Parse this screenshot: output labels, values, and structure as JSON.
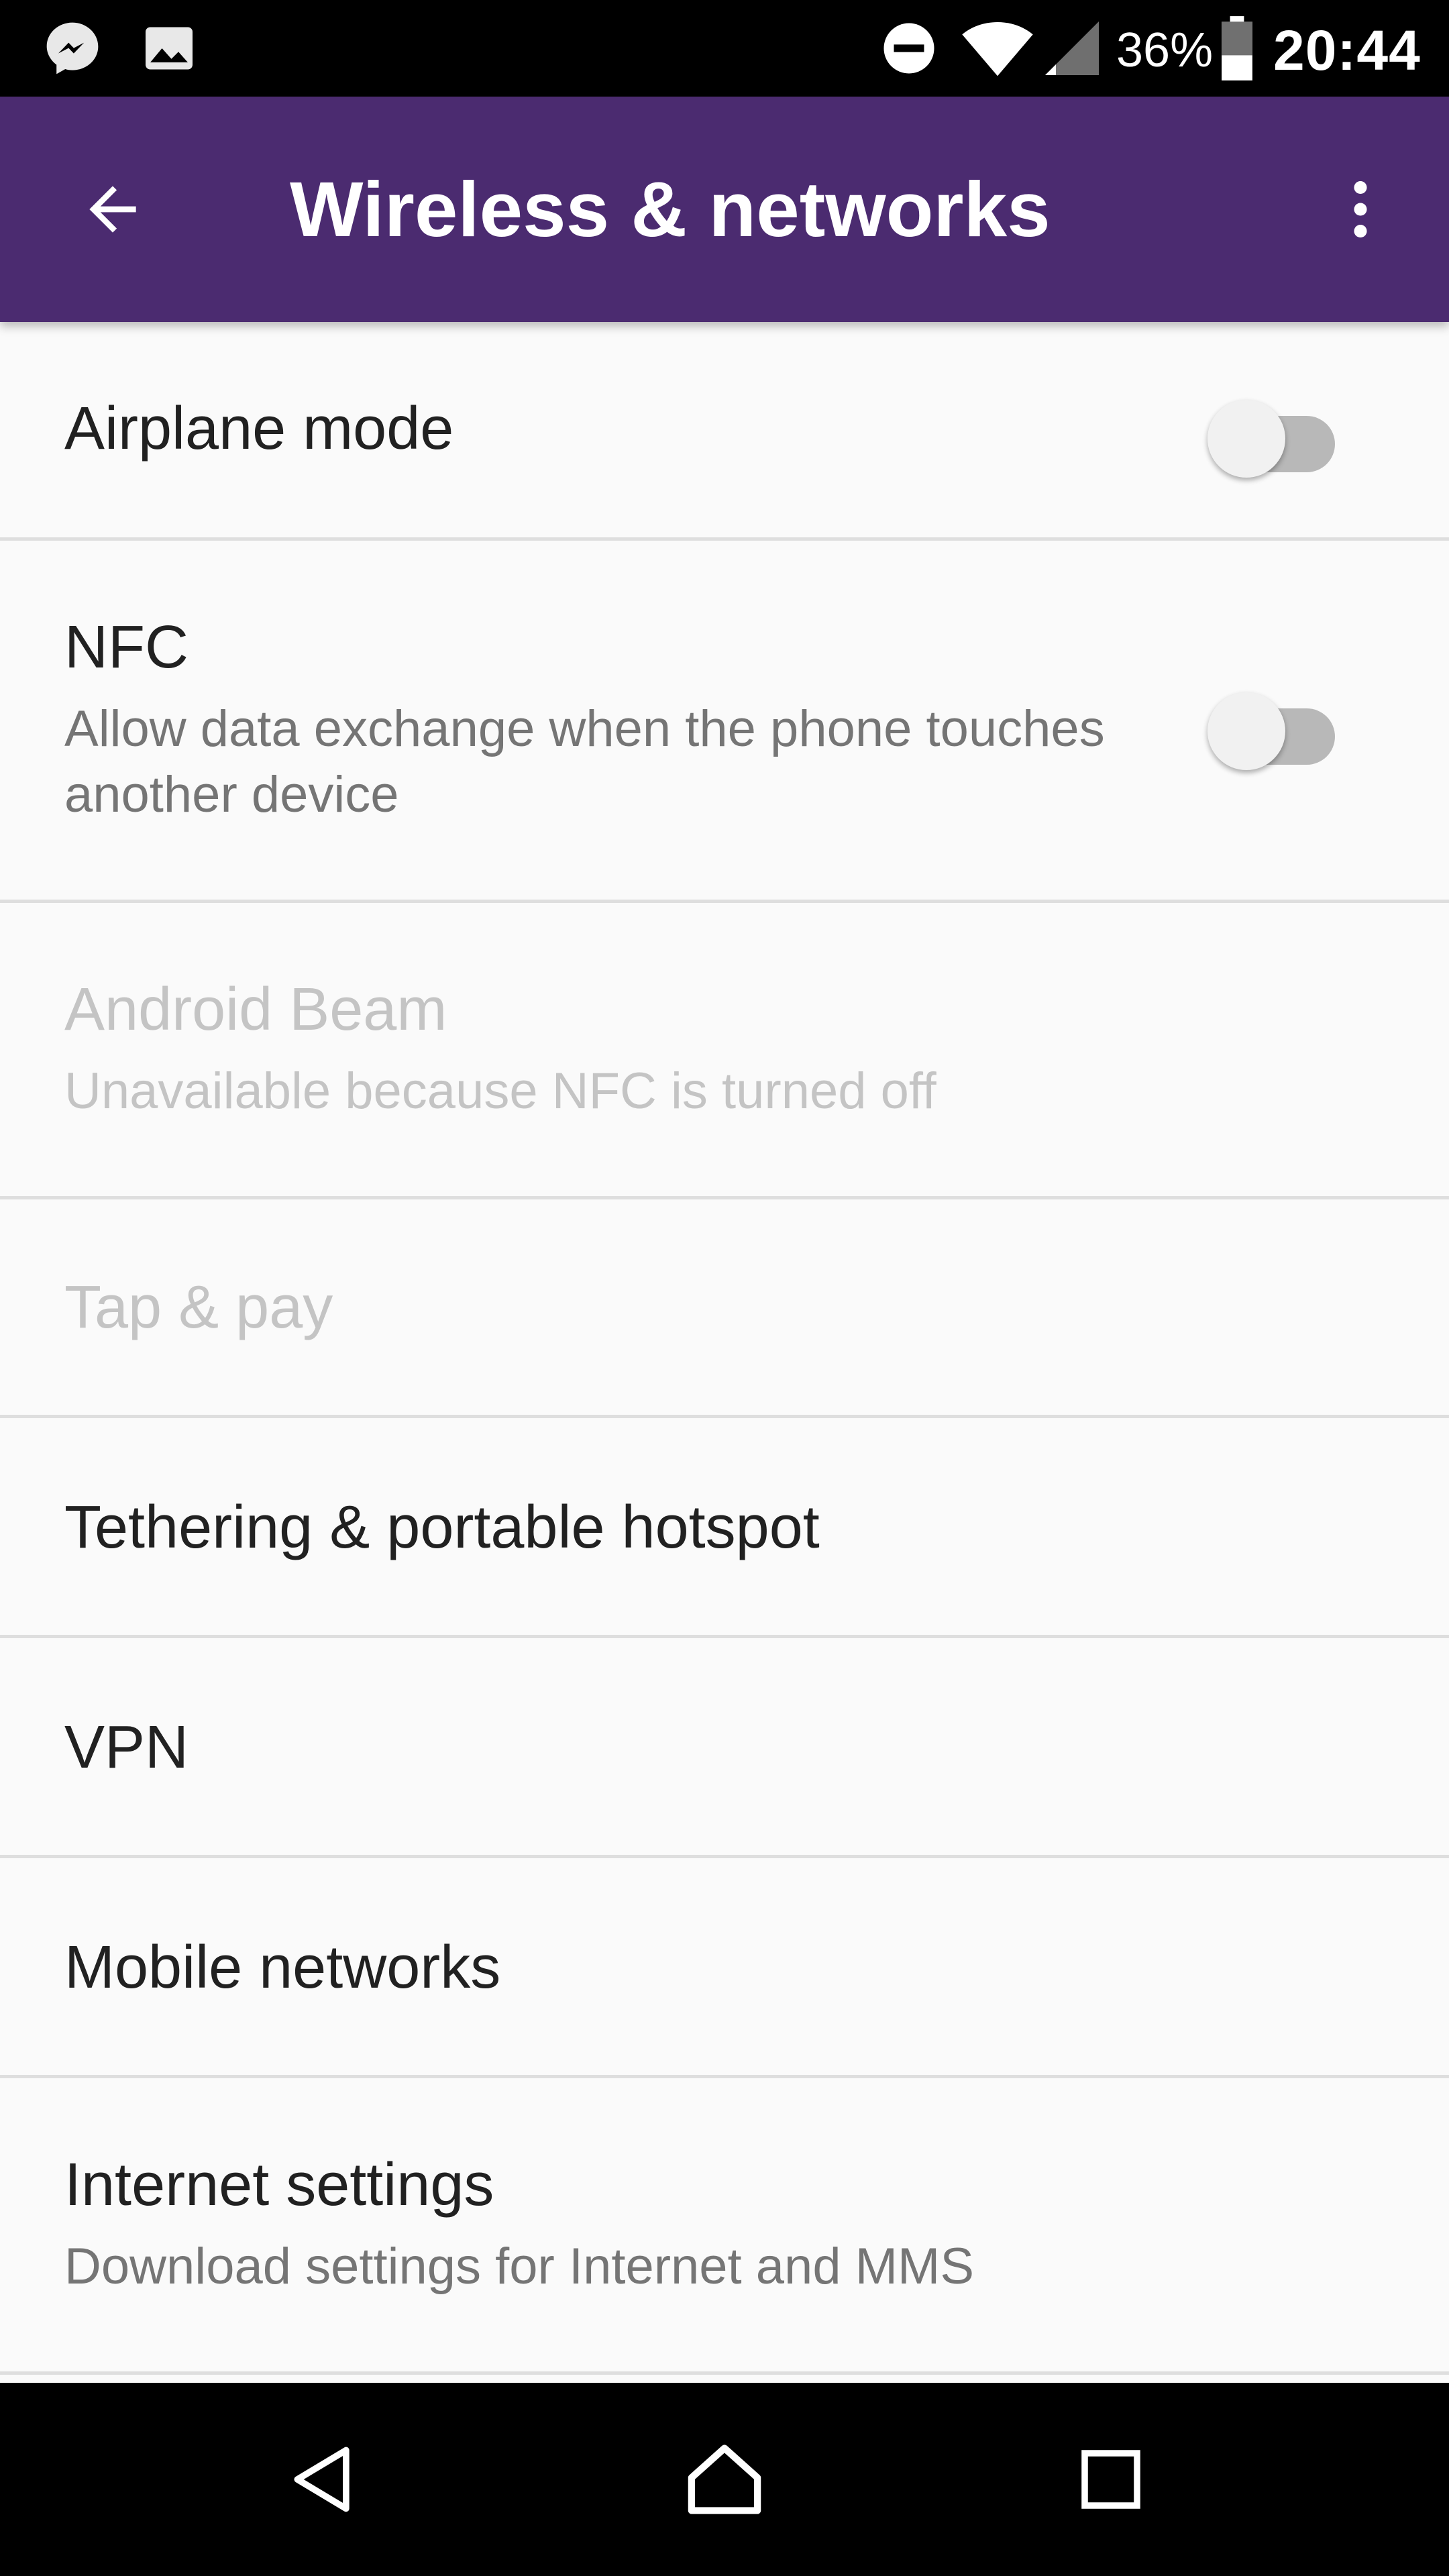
{
  "status_bar": {
    "icons": [
      "messenger-icon",
      "image-icon",
      "do-not-disturb-icon",
      "wifi-icon",
      "signal-icon",
      "battery-icon"
    ],
    "battery_percent": "36%",
    "time": "20:44"
  },
  "toolbar": {
    "title": "Wireless & networks",
    "back_icon": "arrow-back-icon",
    "menu_icon": "more-vert-icon",
    "color": "#4b2b70"
  },
  "settings": {
    "airplane": {
      "label": "Airplane mode",
      "enabled": false
    },
    "nfc": {
      "label": "NFC",
      "summary": "Allow data exchange when the phone touches another device",
      "enabled": false
    },
    "android_beam": {
      "label": "Android Beam",
      "summary": "Unavailable because NFC is turned off",
      "disabled": true
    },
    "tap_pay": {
      "label": "Tap & pay",
      "disabled": true
    },
    "tethering": {
      "label": "Tethering & portable hotspot"
    },
    "vpn": {
      "label": "VPN"
    },
    "mobile_networks": {
      "label": "Mobile networks"
    },
    "internet_settings": {
      "label": "Internet settings",
      "summary": "Download settings for Internet and MMS"
    }
  },
  "nav_bar": {
    "back": "back-triangle-icon",
    "home": "home-icon",
    "recents": "recents-square-icon"
  }
}
